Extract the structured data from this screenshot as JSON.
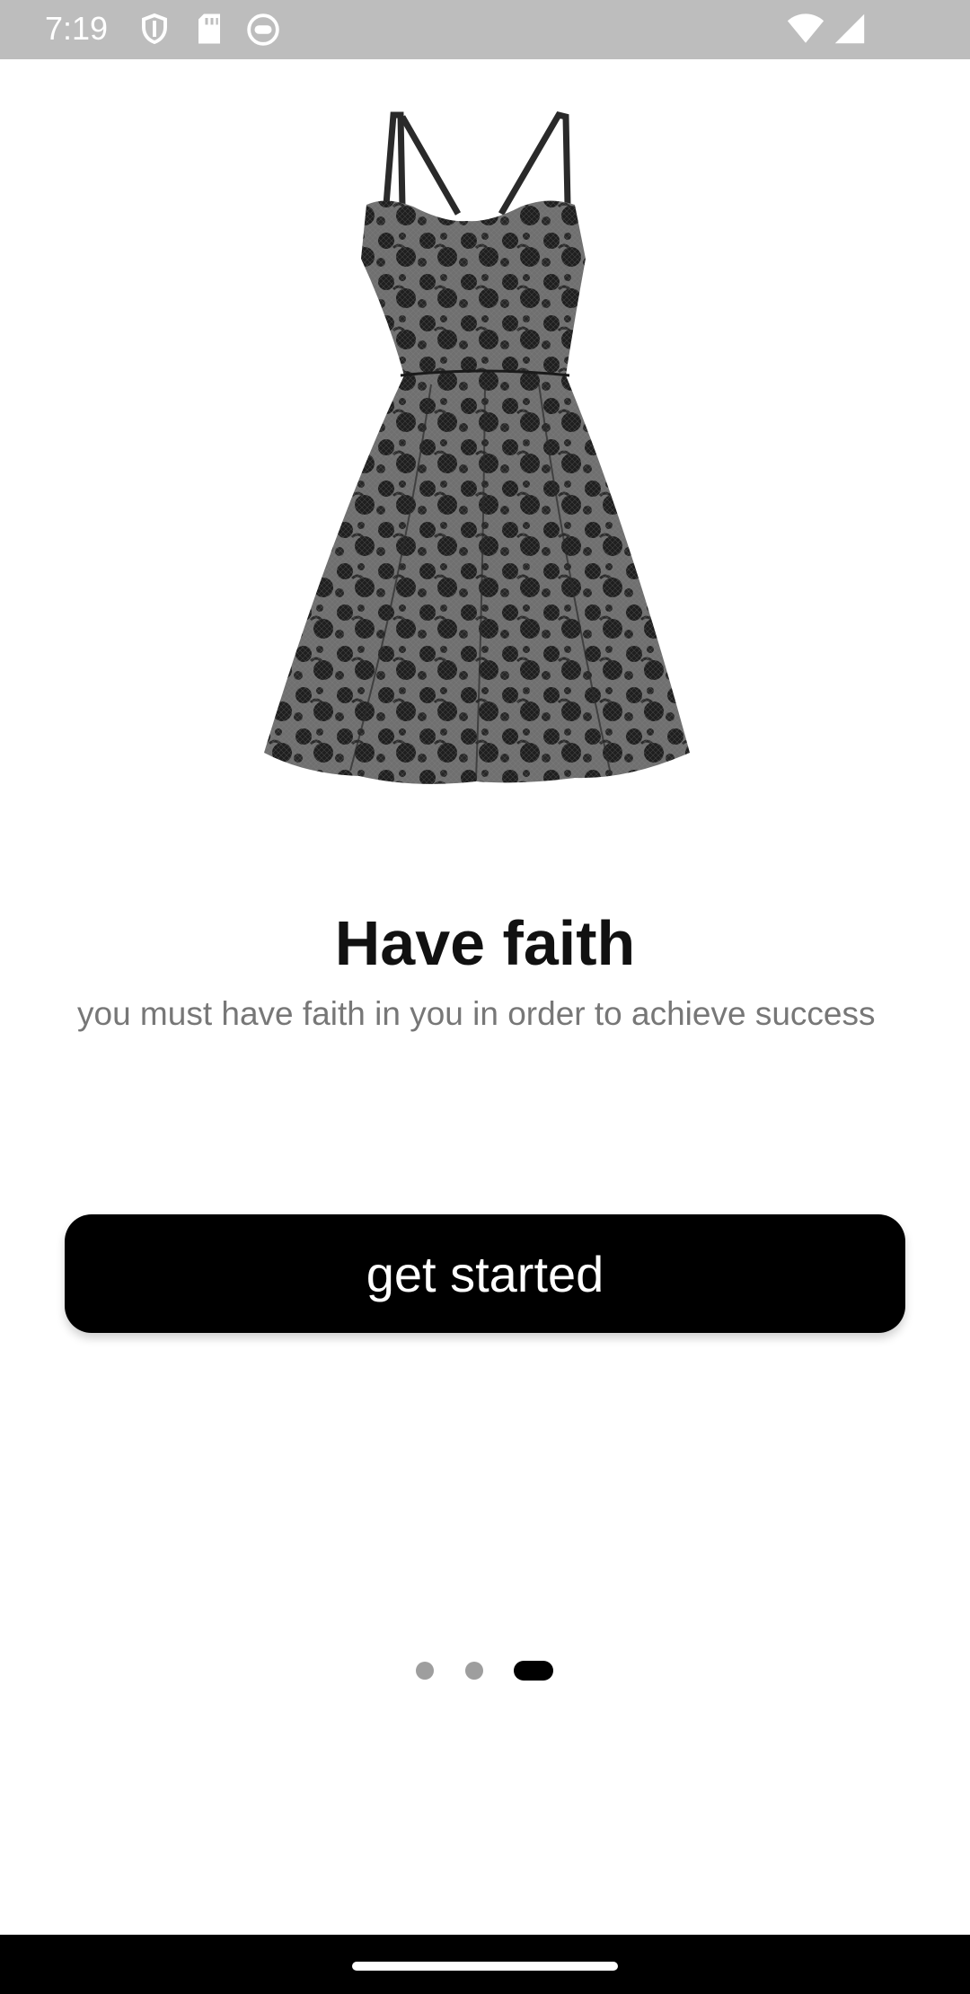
{
  "status_bar": {
    "time": "7:19",
    "icons": [
      "shield-icon",
      "sd-card-icon",
      "face-icon",
      "wifi-icon",
      "signal-icon"
    ]
  },
  "hero": {
    "icon": "dress-image",
    "colors": {
      "fabric": "#6f6f6f",
      "lace": "#1e1e1e"
    }
  },
  "onboarding": {
    "title": "Have faith",
    "subtitle": "you must have faith in you in order to achieve success"
  },
  "cta": {
    "label": "get started"
  },
  "pager": {
    "count": 3,
    "active_index": 2
  },
  "colors": {
    "status_bar_bg": "#bdbdbd",
    "button_bg": "#000000",
    "button_text": "#ffffff",
    "subtitle_text": "#777777",
    "dot_inactive": "#9e9e9e",
    "dot_active": "#000000"
  }
}
